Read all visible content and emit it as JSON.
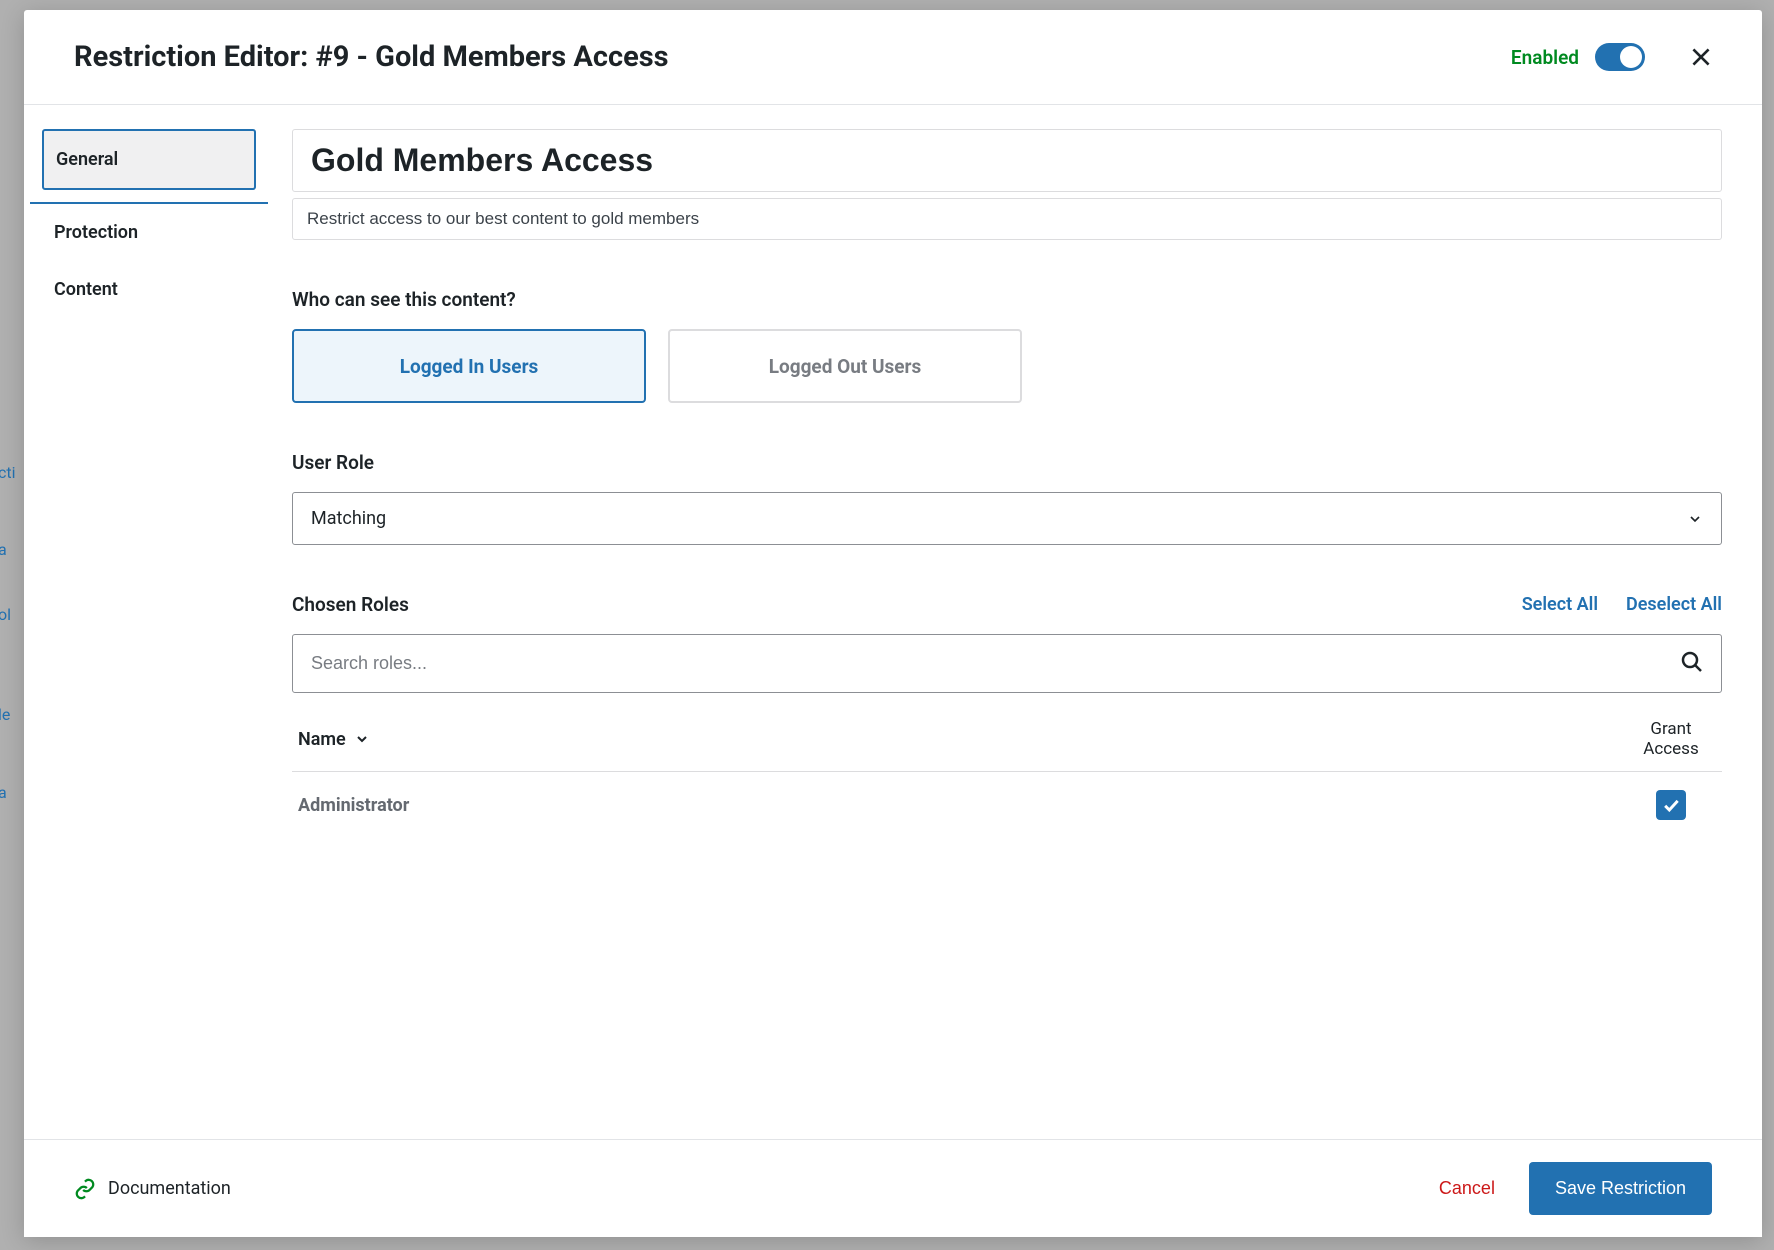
{
  "header": {
    "title": "Restriction Editor: #9 - Gold Members Access",
    "enabled_label": "Enabled",
    "enabled": true
  },
  "tabs": [
    {
      "label": "General",
      "selected": true
    },
    {
      "label": "Protection",
      "selected": false
    },
    {
      "label": "Content",
      "selected": false
    }
  ],
  "general": {
    "title_value": "Gold Members Access",
    "description_value": "Restrict access to our best content to gold members",
    "visibility_question": "Who can see this content?",
    "visibility_options": [
      {
        "label": "Logged In Users",
        "selected": true
      },
      {
        "label": "Logged Out Users",
        "selected": false
      }
    ],
    "user_role_label": "User Role",
    "user_role_value": "Matching",
    "chosen_roles_label": "Chosen Roles",
    "select_all_label": "Select All",
    "deselect_all_label": "Deselect All",
    "search_placeholder": "Search roles...",
    "table": {
      "name_header": "Name",
      "grant_header": "Grant Access",
      "rows": [
        {
          "name": "Administrator",
          "granted": true
        }
      ]
    }
  },
  "footer": {
    "documentation_label": "Documentation",
    "cancel_label": "Cancel",
    "save_label": "Save Restriction"
  }
}
